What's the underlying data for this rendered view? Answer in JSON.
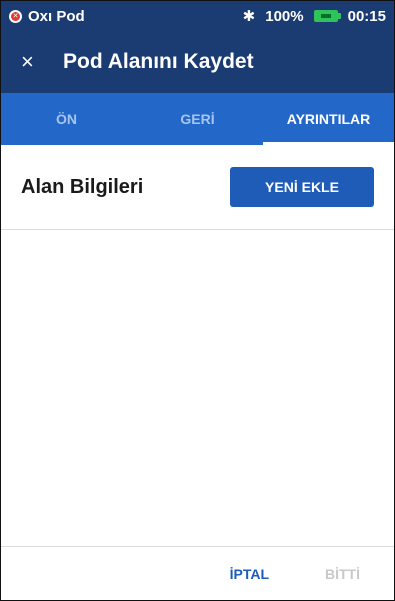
{
  "status_bar": {
    "app_name": "Oxı Pod",
    "battery_percent": "100%",
    "time": "00:15",
    "icons": [
      "pod-alert-icon",
      "bluetooth-icon",
      "battery-charging-icon"
    ]
  },
  "header": {
    "title": "Pod Alanını Kaydet",
    "close_icon": "×"
  },
  "tabs": [
    {
      "label": "ÖN",
      "active": false
    },
    {
      "label": "GERİ",
      "active": false
    },
    {
      "label": "AYRINTILAR",
      "active": true
    }
  ],
  "section": {
    "title": "Alan Bilgileri",
    "add_button_label": "YENİ EKLE"
  },
  "footer": {
    "cancel_label": "İPTAL",
    "done_label": "BİTTİ"
  },
  "colors": {
    "header_bg": "#1b3c72",
    "tab_bg": "#2368c8",
    "primary_button": "#1f5cb8",
    "disabled_text": "#c9c9c9"
  }
}
